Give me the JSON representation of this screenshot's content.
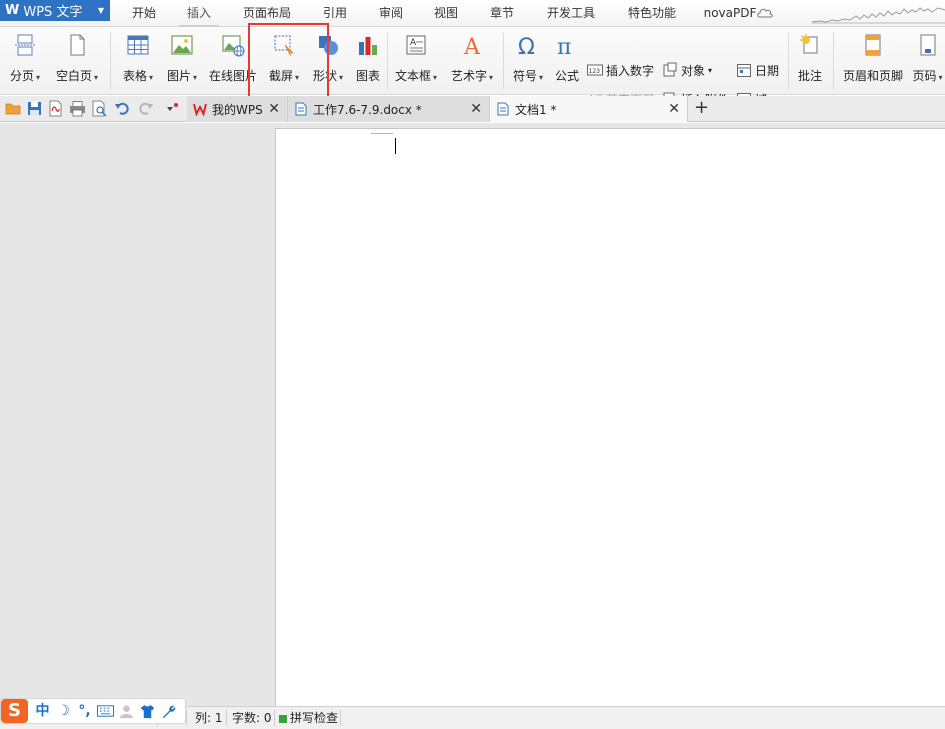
{
  "app": {
    "name": "WPS 文字",
    "logo_letter": "W"
  },
  "menu": {
    "tabs": [
      {
        "label": "开始"
      },
      {
        "label": "插入"
      },
      {
        "label": "页面布局"
      },
      {
        "label": "引用"
      },
      {
        "label": "审阅"
      },
      {
        "label": "视图"
      },
      {
        "label": "章节"
      },
      {
        "label": "开发工具"
      },
      {
        "label": "特色功能"
      },
      {
        "label": "novaPDF"
      }
    ],
    "active_tab": "插入"
  },
  "ribbon": {
    "page_break": "分页",
    "blank_page": "空白页",
    "table": "表格",
    "picture": "图片",
    "online_picture": "在线图片",
    "screenshot": "截屏",
    "shape": "形状",
    "chart": "图表",
    "text_box": "文本框",
    "word_art": "艺术字",
    "symbol": "符号",
    "formula": "公式",
    "insert_number": "插入数字",
    "drop_cap": "首字下沉",
    "object": "对象",
    "insert_attachment": "插入附件",
    "date": "日期",
    "field": "域",
    "comment": "批注",
    "header_footer": "页眉和页脚",
    "page_number": "页码",
    "number_icon_text": "123"
  },
  "doc_tabs": [
    {
      "label": "我的WPS",
      "active": false
    },
    {
      "label": "工作7.6-7.9.docx *",
      "active": false
    },
    {
      "label": "文档1 *",
      "active": true
    }
  ],
  "status": {
    "col": "列: 1",
    "word_count": "字数: 0",
    "spell_check": "拼写检查"
  },
  "ime": {
    "logo": "S",
    "mode": "中",
    "moon": "☽",
    "punct": "°,"
  },
  "colors": {
    "accent": "#2e72c6",
    "highlight": "#e53935",
    "wps_red": "#d7282f",
    "ime_orange": "#f26522"
  }
}
